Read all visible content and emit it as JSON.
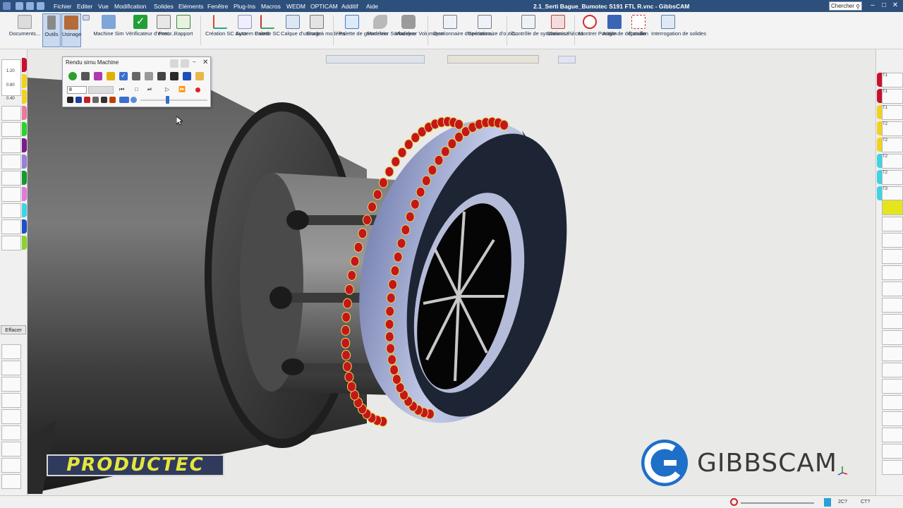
{
  "titlebar": {
    "menu": [
      "Fichier",
      "Editer",
      "Vue",
      "Modification",
      "Solides",
      "Eléments",
      "Fenêtre",
      "Plug-Ins",
      "Macros",
      "WEDM",
      "OPTICAM",
      "Additif",
      "Aide"
    ],
    "document_title": "2.1_Serti Bague_Bumotec S191 FTL R.vnc - GibbsCAM",
    "search_placeholder": "Chercher",
    "window_buttons": [
      "minimize",
      "restore",
      "close"
    ]
  },
  "ribbon": {
    "buttons": [
      {
        "label": "Documents...",
        "icon": "documents-icon"
      },
      {
        "label": "Outils",
        "icon": "tools-icon",
        "selected": true
      },
      {
        "label": "Usinage",
        "icon": "machining-icon",
        "selected": true
      },
      {
        "label": "Machine Sim",
        "icon": "machine-sim-icon"
      },
      {
        "label": "Vérificateur d'erreur...",
        "icon": "checkmark-icon"
      },
      {
        "label": "Post",
        "icon": "post-icon"
      },
      {
        "label": "Rapport",
        "icon": "report-icon"
      },
      {
        "label": "Création SC Auto",
        "icon": "cs-auto-icon"
      },
      {
        "label": "System Coord.",
        "icon": "coord-system-icon"
      },
      {
        "label": "Palette SC",
        "icon": "cs-palette-icon"
      },
      {
        "label": "Calque d'usinage",
        "icon": "machining-layer-icon"
      },
      {
        "label": "Stock à modèles",
        "icon": "stock-models-icon"
      },
      {
        "label": "Palette de géométrie",
        "icon": "geometry-palette-icon"
      },
      {
        "label": "Modeleur Surfacique",
        "icon": "surface-modeler-icon"
      },
      {
        "label": "Modeleur Volumique",
        "icon": "solid-modeler-icon"
      },
      {
        "label": "Gestionnaire d'opération...",
        "icon": "operation-manager-icon"
      },
      {
        "label": "Gestionnaire d'outils...",
        "icon": "tool-manager-icon"
      },
      {
        "label": "Contrôle de synchronisa...",
        "icon": "sync-control-icon"
      },
      {
        "label": "Stations Pièces",
        "icon": "part-stations-icon"
      },
      {
        "label": "Montrer Position",
        "icon": "show-position-icon"
      },
      {
        "label": "Angle de dépouille",
        "icon": "draft-angle-icon"
      },
      {
        "label": "Cotation",
        "icon": "dimension-icon"
      },
      {
        "label": "Interrogation de solides",
        "icon": "solid-query-icon"
      }
    ]
  },
  "sim_panel": {
    "title": "Rendu simu Machine",
    "speed_value": "8"
  },
  "left_strip": {
    "values": [
      "1.20",
      "0.80",
      "0.40"
    ],
    "clear_label": "Effacer"
  },
  "right_strip": {
    "tool_labels": [
      "T1",
      "T1",
      "T1",
      "T2",
      "T2",
      "T2",
      "T2",
      "T3",
      "T3"
    ]
  },
  "logos": {
    "productec": "PRODUCTEC",
    "gibbscam": "GIBBSCAM"
  },
  "statusbar": {
    "item1": "2C?",
    "item2": "CT?"
  },
  "colors": {
    "title_bg": "#2d4f7c",
    "ring": "#aab4d8",
    "gem": "#c4161c",
    "dark_face": "#1d2535"
  }
}
